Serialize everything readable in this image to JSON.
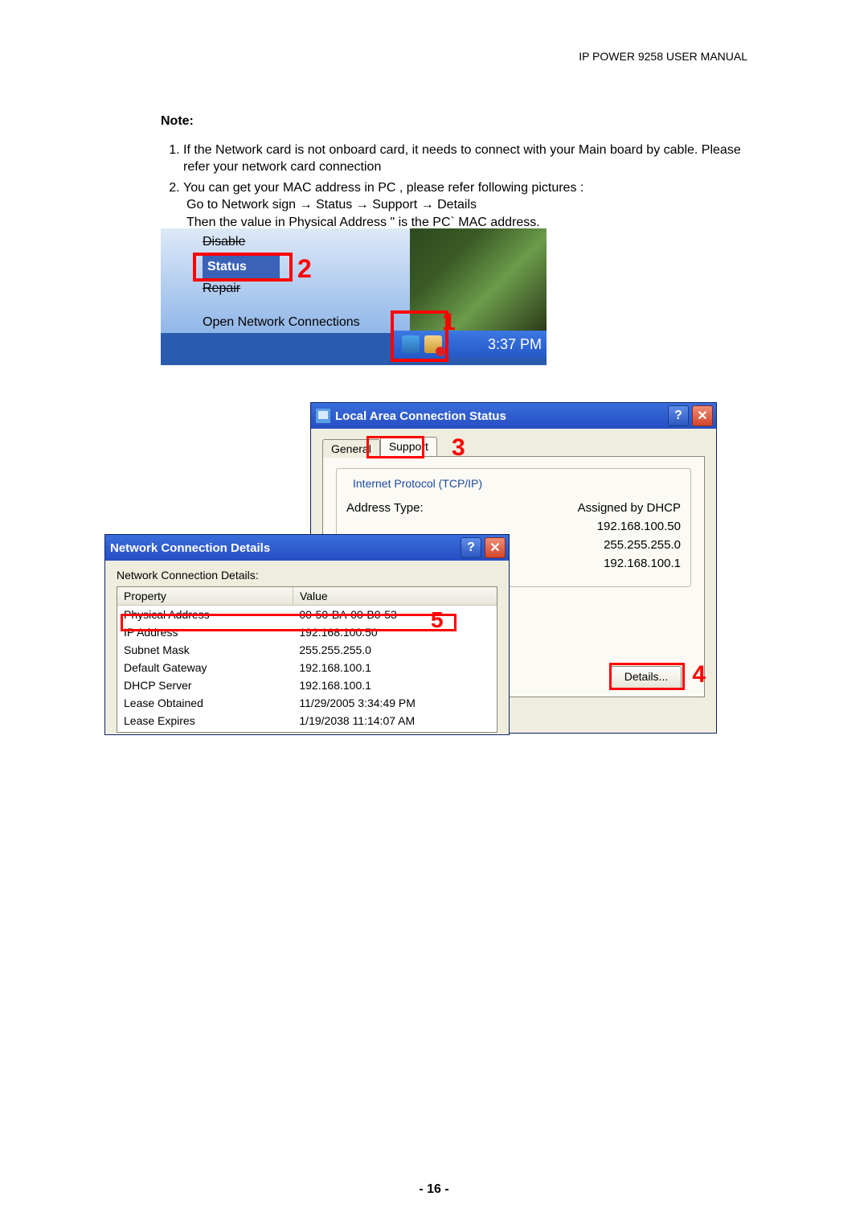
{
  "header": "IP POWER 9258 USER MANUAL",
  "note": {
    "title": "Note:",
    "items": [
      "If the Network card is not onboard card, it needs to connect with your Main board by cable. Please refer your network card connection",
      "You can get your MAC address in PC , please refer following pictures :"
    ],
    "sub2a": "Go to Network sign → Status → Support → Details",
    "sub2b": "Then the value in Physical Address \" is the PC` MAC address."
  },
  "ctx": {
    "disable": "Disable",
    "status": "Status",
    "repair": "Repair",
    "open": "Open Network Connections"
  },
  "tray": {
    "time": "3:37 PM"
  },
  "annotations": {
    "n1": "1",
    "n2": "2",
    "n3": "3",
    "n4": "4",
    "n5": "5"
  },
  "status_win": {
    "title": "Local Area Connection Status",
    "tabs": {
      "general": "General",
      "support": "Support"
    },
    "group_title": "Internet Protocol (TCP/IP)",
    "rows": {
      "addr_type_label": "Address Type:",
      "addr_type_value": "Assigned by DHCP",
      "ip_value": "192.168.100.50",
      "mask_value": "255.255.255.0",
      "gw_value": "192.168.100.1"
    },
    "details_btn": "Details..."
  },
  "details_win": {
    "title": "Network Connection Details",
    "label": "Network Connection Details:",
    "col1": "Property",
    "col2": "Value",
    "rows": [
      {
        "p": "Physical Address",
        "v": "00-50-BA-00-B0-53"
      },
      {
        "p": "IP Address",
        "v": "192.168.100.50"
      },
      {
        "p": "Subnet Mask",
        "v": "255.255.255.0"
      },
      {
        "p": "Default Gateway",
        "v": "192.168.100.1"
      },
      {
        "p": "DHCP Server",
        "v": "192.168.100.1"
      },
      {
        "p": "Lease Obtained",
        "v": "11/29/2005 3:34:49 PM"
      },
      {
        "p": "Lease Expires",
        "v": "1/19/2038 11:14:07 AM"
      }
    ]
  },
  "page_number": "- 16 -",
  "glyphs": {
    "help": "?",
    "close": "✕"
  }
}
